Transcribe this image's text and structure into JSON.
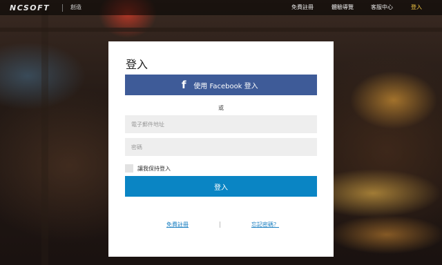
{
  "header": {
    "logo": "NCSOFT",
    "subtitle": "創造",
    "nav": [
      {
        "label": "免費註冊",
        "active": false
      },
      {
        "label": "體驗導覽",
        "active": false
      },
      {
        "label": "客服中心",
        "active": false
      },
      {
        "label": "登入",
        "active": true
      }
    ]
  },
  "login": {
    "title": "登入",
    "facebook_icon": "f",
    "facebook_label": "使用 Facebook 登入",
    "or_text": "或",
    "email_placeholder": "電子郵件地址",
    "password_placeholder": "密碼",
    "remember_label": "讓我保持登入",
    "submit_label": "登入",
    "register_link": "免費註冊",
    "forgot_link": "忘記密碼？"
  },
  "colors": {
    "facebook": "#3e5b98",
    "primary": "#0a85c4",
    "nav_active": "#f2c744"
  }
}
